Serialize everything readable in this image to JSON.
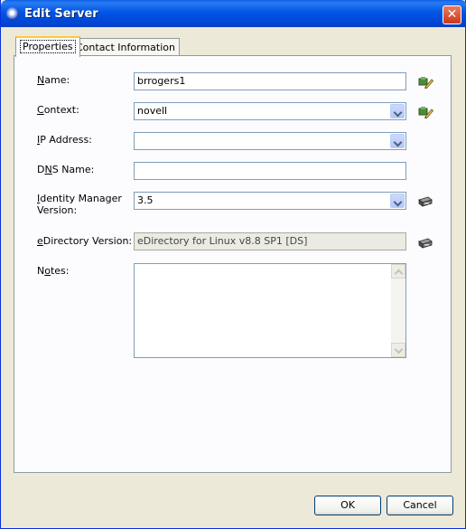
{
  "window": {
    "title": "Edit Server",
    "close_glyph": "✕"
  },
  "tabs": [
    {
      "label": "Properties",
      "active": true
    },
    {
      "label": "Contact Information",
      "active": false
    }
  ],
  "form": {
    "name": {
      "label_mn": "N",
      "label_rest": "ame:",
      "value": "brrogers1",
      "icon": "browse-edit-icon"
    },
    "context": {
      "label_mn": "C",
      "label_rest": "ontext:",
      "value": "novell",
      "icon": "browse-edit-icon"
    },
    "ip": {
      "label_mn": "I",
      "label_rest": "P Address:",
      "value": ""
    },
    "dns": {
      "label_pre": "D",
      "label_mn": "N",
      "label_rest": "S Name:",
      "value": ""
    },
    "idm": {
      "label_mn": "I",
      "label_rest": "dentity Manager",
      "label_line2": "Version:",
      "value": "3.5",
      "icon": "refresh-version-icon"
    },
    "edir": {
      "label_mn": "e",
      "label_rest": "Directory Version:",
      "value": "eDirectory for Linux v8.8 SP1 [DS]",
      "icon": "refresh-version-icon"
    },
    "notes": {
      "label_pre": "N",
      "label_mn": "o",
      "label_rest": "tes:",
      "value": ""
    }
  },
  "buttons": {
    "ok": "OK",
    "cancel": "Cancel"
  },
  "colors": {
    "title_bar": "#0055e5",
    "window_bg": "#ece9d8",
    "panel_bg": "#fcfcfe",
    "field_border": "#7f9db9"
  }
}
